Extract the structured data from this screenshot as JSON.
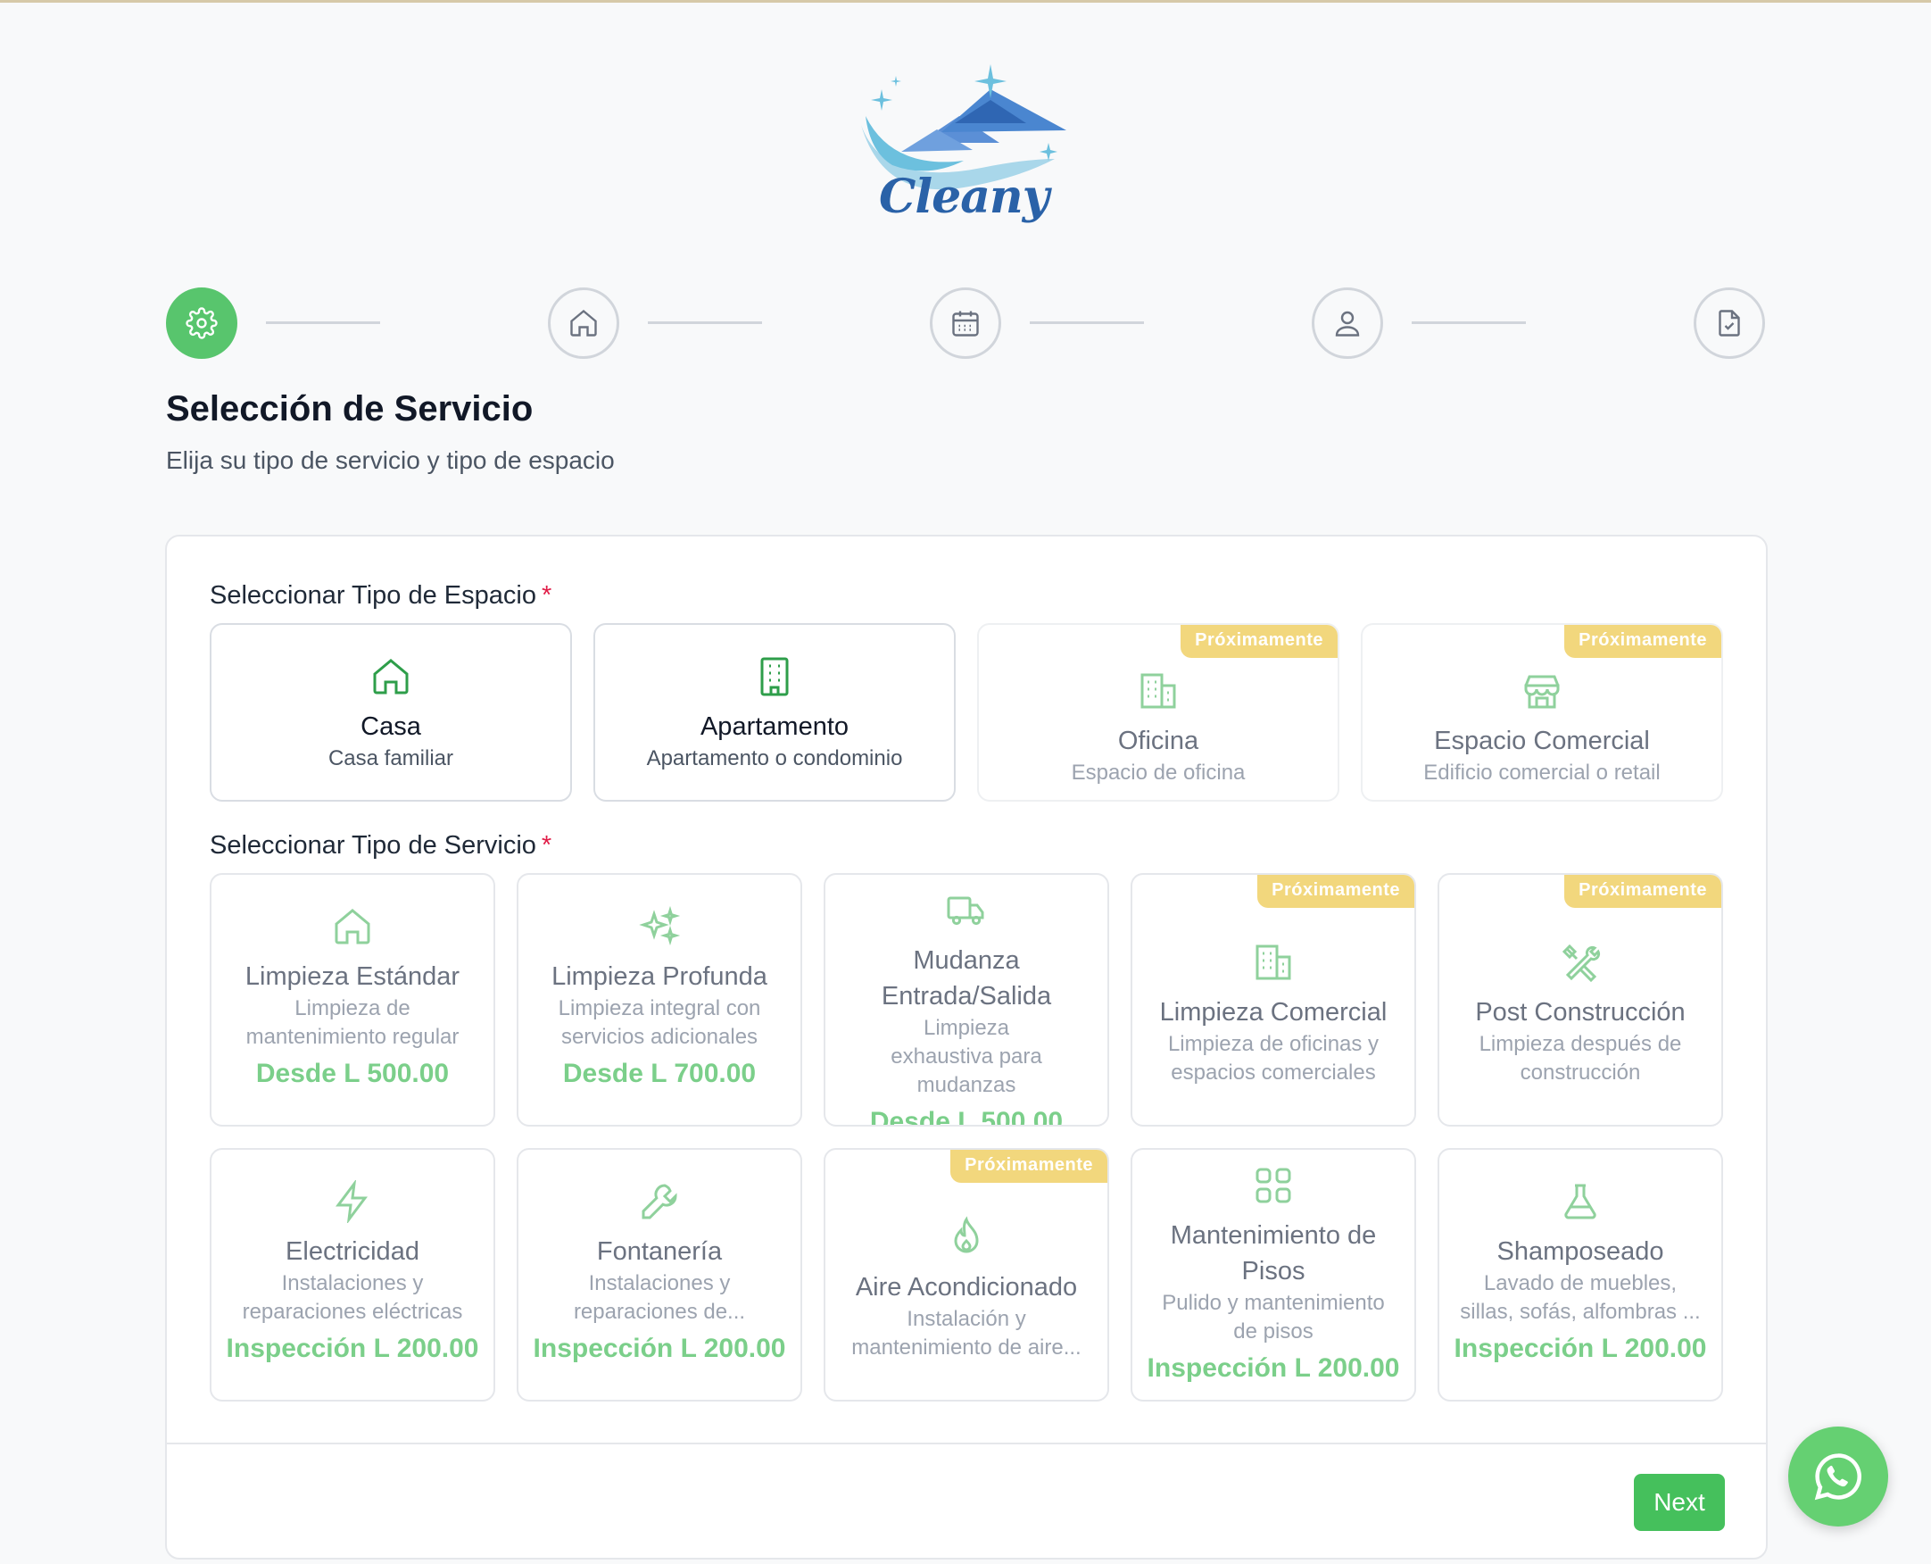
{
  "brand": {
    "name": "Cleany"
  },
  "stepper": {
    "steps": [
      {
        "icon": "gear-icon",
        "active": true
      },
      {
        "icon": "home-icon",
        "active": false
      },
      {
        "icon": "calendar-icon",
        "active": false
      },
      {
        "icon": "user-icon",
        "active": false
      },
      {
        "icon": "document-check-icon",
        "active": false
      }
    ]
  },
  "header": {
    "title": "Selección de Servicio",
    "subtitle": "Elija su tipo de servicio y tipo de espacio"
  },
  "space_section": {
    "label": "Seleccionar Tipo de Espacio",
    "required_mark": "*",
    "items": [
      {
        "title": "Casa",
        "subtitle": "Casa familiar",
        "icon": "home-icon",
        "badge": ""
      },
      {
        "title": "Apartamento",
        "subtitle": "Apartamento o condominio",
        "icon": "building-icon",
        "badge": ""
      },
      {
        "title": "Oficina",
        "subtitle": "Espacio de oficina",
        "icon": "office-building-icon",
        "badge": "Próximamente"
      },
      {
        "title": "Espacio Comercial",
        "subtitle": "Edificio comercial o retail",
        "icon": "store-icon",
        "badge": "Próximamente"
      }
    ]
  },
  "service_section": {
    "label": "Seleccionar Tipo de Servicio",
    "required_mark": "*",
    "items": [
      {
        "title": "Limpieza Estándar",
        "subtitle": "Limpieza de mantenimiento regular",
        "price": "Desde L 500.00",
        "icon": "home-icon",
        "badge": ""
      },
      {
        "title": "Limpieza Profunda",
        "subtitle": "Limpieza integral con servicios adicionales",
        "price": "Desde L 700.00",
        "icon": "sparkles-icon",
        "badge": ""
      },
      {
        "title": "Mudanza Entrada/Salida",
        "subtitle": "Limpieza exhaustiva para mudanzas",
        "price": "Desde L 500.00",
        "icon": "truck-icon",
        "badge": ""
      },
      {
        "title": "Limpieza Comercial",
        "subtitle": "Limpieza de oficinas y espacios comerciales",
        "price": "",
        "icon": "office-building-icon",
        "badge": "Próximamente"
      },
      {
        "title": "Post Construcción",
        "subtitle": "Limpieza después de construcción",
        "price": "",
        "icon": "tools-icon",
        "badge": "Próximamente"
      },
      {
        "title": "Electricidad",
        "subtitle": "Instalaciones y reparaciones eléctricas",
        "price": "Inspección L 200.00",
        "icon": "lightning-icon",
        "badge": ""
      },
      {
        "title": "Fontanería",
        "subtitle": "Instalaciones y reparaciones de...",
        "price": "Inspección L 200.00",
        "icon": "wrench-icon",
        "badge": ""
      },
      {
        "title": "Aire Acondicionado",
        "subtitle": "Instalación y mantenimiento de aire...",
        "price": "",
        "icon": "flame-icon",
        "badge": "Próximamente"
      },
      {
        "title": "Mantenimiento de Pisos",
        "subtitle": "Pulido y mantenimiento de pisos",
        "price": "Inspección L 200.00",
        "icon": "grid-icon",
        "badge": ""
      },
      {
        "title": "Shamposeado",
        "subtitle": "Lavado de muebles, sillas, sofás, alfombras ...",
        "price": "Inspección L 200.00",
        "icon": "flask-icon",
        "badge": ""
      }
    ]
  },
  "footer": {
    "next_label": "Next"
  },
  "colors": {
    "accent": "#45c05c",
    "price": "#7bcf8a",
    "badge": "#f2d77d",
    "brand": "#2a62a8"
  }
}
